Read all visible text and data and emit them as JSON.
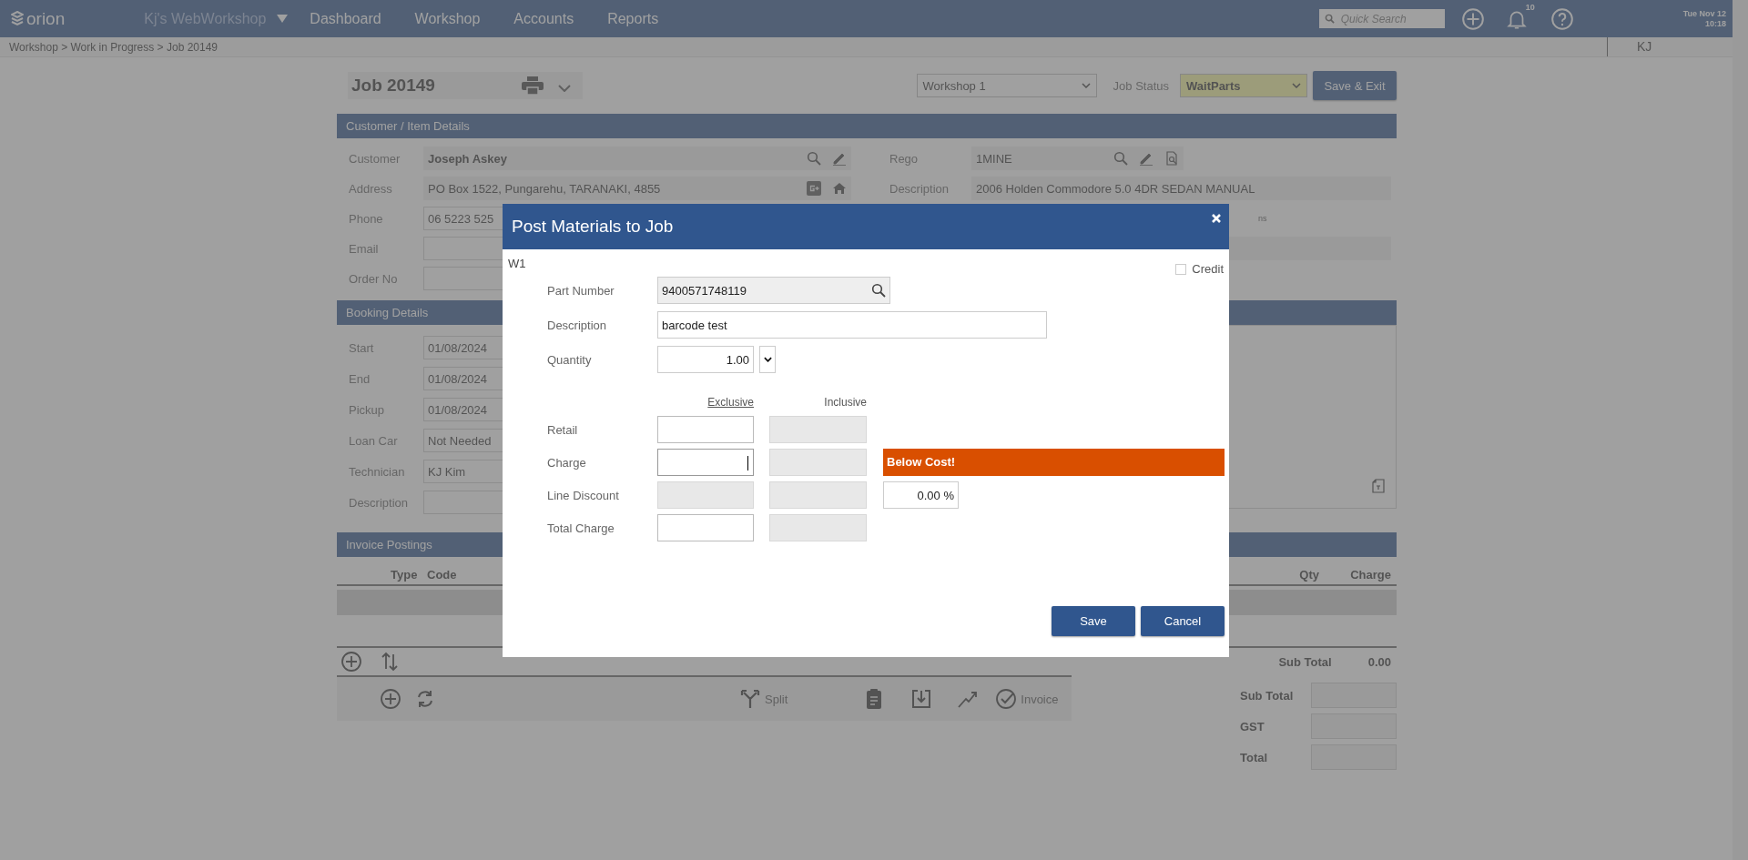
{
  "top_bar": {
    "logo": "orion",
    "workshop_name": "Kj's WebWorkshop",
    "nav": [
      "Dashboard",
      "Workshop",
      "Accounts",
      "Reports"
    ],
    "search": {
      "placeholder": "Quick Search"
    },
    "notification_count": "10",
    "date": "Tue Nov 12",
    "time": "10:18"
  },
  "breadcrumb": "Workshop > Work in Progress > Job 20149",
  "user_initials": "KJ",
  "job": {
    "title": "Job 20149",
    "workshop": "Workshop 1",
    "status_label": "Job Status",
    "status": "WaitParts",
    "save_exit": "Save & Exit"
  },
  "customer_section": {
    "title": "Customer / Item Details",
    "left_fields": [
      {
        "label": "Customer",
        "value": "Joseph Askey",
        "kind": "customer"
      },
      {
        "label": "Address",
        "value": "PO Box 1522, Pungarehu, TARANAKI, 4855",
        "kind": "address"
      },
      {
        "label": "Phone",
        "value": "06 5223 525",
        "kind": "plain"
      },
      {
        "label": "Email",
        "kind": "plain"
      },
      {
        "label": "Order No",
        "kind": "plain"
      }
    ],
    "right_fields": [
      {
        "label": "Rego",
        "value": "1MINE",
        "kind": "rego"
      },
      {
        "label": "Description",
        "value": "2006 Holden Commodore 5.0 4DR SEDAN MANUAL",
        "kind": "wide"
      }
    ],
    "partial_text": "ns"
  },
  "booking_section": {
    "title": "Booking Details",
    "fields": [
      {
        "label": "Start",
        "value": "01/08/2024"
      },
      {
        "label": "End",
        "value": "01/08/2024"
      },
      {
        "label": "Pickup",
        "value": "01/08/2024"
      },
      {
        "label": "Loan Car",
        "value": "Not Needed"
      },
      {
        "label": "Technician",
        "value": "KJ Kim"
      },
      {
        "label": "Description"
      }
    ]
  },
  "invoice_section": {
    "title": "Invoice Postings",
    "columns": [
      "Type",
      "Code",
      "Qty",
      "Charge"
    ],
    "subtotal_label": "Sub Total",
    "subtotal": "0.00",
    "toolbar": [
      {
        "kind": "icon"
      },
      {
        "kind": "icon"
      },
      {
        "kind": "labeled",
        "label": "Split"
      },
      {
        "kind": "icon"
      },
      {
        "kind": "icon"
      },
      {
        "kind": "icon"
      },
      {
        "kind": "labeled",
        "label": "Invoice"
      }
    ],
    "totals": [
      "Sub Total",
      "GST",
      "Total"
    ]
  },
  "dialog": {
    "title": "Post Materials to Job",
    "code": "W1",
    "credit": {
      "label": "Credit",
      "checked": false
    },
    "part_number": {
      "label": "Part Number",
      "value": "9400571748119"
    },
    "description": {
      "label": "Description",
      "value": "barcode test"
    },
    "quantity": {
      "label": "Quantity",
      "value": "1.00"
    },
    "price_modes": [
      {
        "label": "Exclusive",
        "selected": true
      },
      {
        "label": "Inclusive",
        "selected": false
      }
    ],
    "price_rows": [
      {
        "label": "Retail",
        "exclusive_editable": true,
        "inclusive_editable": false
      },
      {
        "label": "Charge",
        "exclusive_editable": true,
        "inclusive_editable": false,
        "focused": true,
        "warning": "Below Cost!"
      },
      {
        "label": "Line Discount",
        "exclusive_editable": false,
        "inclusive_editable": false,
        "discount": "0.00 %"
      },
      {
        "label": "Total Charge",
        "exclusive_editable": true,
        "inclusive_editable": false
      }
    ],
    "buttons": [
      "Save",
      "Cancel"
    ]
  }
}
